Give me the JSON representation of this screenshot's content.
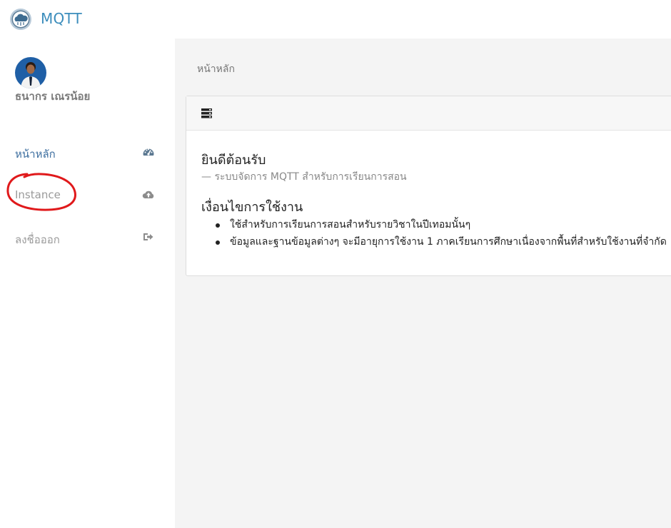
{
  "header": {
    "app_title": "MQTT",
    "logo_icon": "cloud-icon",
    "brand_color": "#3c8dbc"
  },
  "sidebar": {
    "user_name": "ธนากร เณรน้อย",
    "items": [
      {
        "label": "หน้าหลัก",
        "icon": "dashboard-icon",
        "active": true
      },
      {
        "label": "Instance",
        "icon": "cloud-upload-icon",
        "active": false
      },
      {
        "label": "ลงชื่อออก",
        "icon": "sign-out-icon",
        "active": false
      }
    ]
  },
  "main": {
    "breadcrumb": "หน้าหลัก",
    "card": {
      "header_icon": "server-icon",
      "welcome_title": "ยินดีต้อนรับ",
      "welcome_subtitle": "— ระบบจัดการ MQTT สำหรับการเรียนการสอน",
      "terms_title": "เงื่อนไขการใช้งาน",
      "terms": [
        "ใช้สำหรับการเรียนการสอนสำหรับรายวิชาในปีเทอมนั้นๆ",
        "ข้อมูลและฐานข้อมูลต่างๆ จะมีอายุการใช้งาน 1 ภาคเรียนการศึกษาเนื่องจากพื้นที่สำหรับใช้งานที่จำกัด"
      ]
    }
  },
  "annotation_color": "#e0191b"
}
